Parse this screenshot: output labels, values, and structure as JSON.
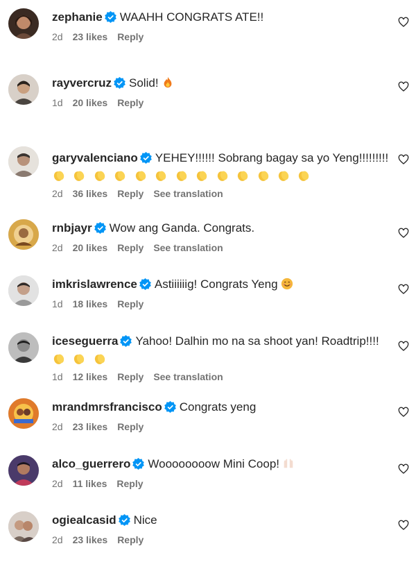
{
  "comments": [
    {
      "username": "zephanie",
      "text": "WAAHH CONGRATS ATE!!",
      "time": "2d",
      "likes": "23 likes",
      "reply": "Reply",
      "translate": "",
      "avatar_color": "#6b4a3a"
    },
    {
      "username": "rayvercruz",
      "text": "Solid!",
      "time": "1d",
      "likes": "20 likes",
      "reply": "Reply",
      "translate": "",
      "avatar_color": "#5a5550"
    },
    {
      "username": "garyvalenciano",
      "text": "YEHEY!!!!!! Sobrang bagay sa yo Yeng!!!!!!!!!",
      "time": "2d",
      "likes": "36 likes",
      "reply": "Reply",
      "translate": "See translation",
      "avatar_color": "#8a7a70"
    },
    {
      "username": "rnbjayr",
      "text": "Wow ang Ganda. Congrats.",
      "time": "2d",
      "likes": "20 likes",
      "reply": "Reply",
      "translate": "See translation",
      "avatar_color": "#c9a24a"
    },
    {
      "username": "imkrislawrence",
      "text": "Astiiiiiig! Congrats Yeng",
      "time": "1d",
      "likes": "18 likes",
      "reply": "Reply",
      "translate": "",
      "avatar_color": "#9a9a9a"
    },
    {
      "username": "iceseguerra",
      "text": "Yahoo! Dalhin mo na sa shoot yan! Roadtrip!!!!",
      "time": "1d",
      "likes": "12 likes",
      "reply": "Reply",
      "translate": "See translation",
      "avatar_color": "#4a4a4a"
    },
    {
      "username": "mrandmrsfrancisco",
      "text": "Congrats yeng",
      "time": "2d",
      "likes": "23 likes",
      "reply": "Reply",
      "translate": "",
      "avatar_color": "#d98a2a"
    },
    {
      "username": "alco_guerrero",
      "text": "Woooooooow Mini Coop!",
      "time": "2d",
      "likes": "11 likes",
      "reply": "Reply",
      "translate": "",
      "avatar_color": "#7a3a5a"
    },
    {
      "username": "ogiealcasid",
      "text": "Nice",
      "time": "2d",
      "likes": "23 likes",
      "reply": "Reply",
      "translate": "",
      "avatar_color": "#6a5a55"
    }
  ],
  "icons": {
    "verified": "verified-badge-icon",
    "heart": "heart-outline-icon"
  },
  "colors": {
    "verified": "#0095f6",
    "meta": "#737373",
    "text": "#262626"
  }
}
